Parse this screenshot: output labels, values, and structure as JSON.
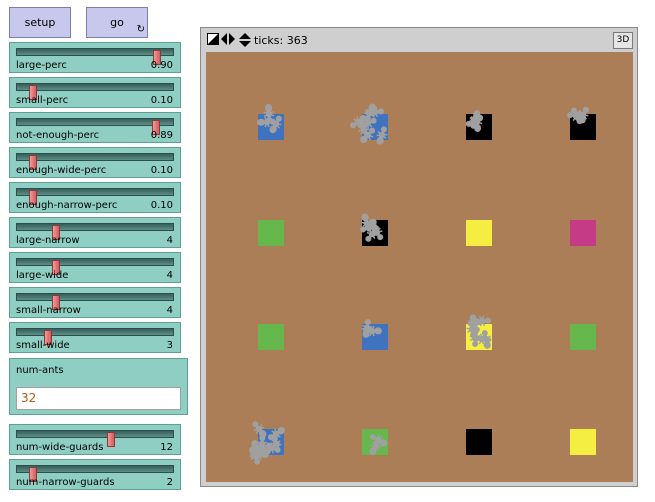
{
  "buttons": {
    "setup": "setup",
    "go": "go",
    "go_forever_icon": "forever-loop-icon"
  },
  "sliders": [
    {
      "label": "large-perc",
      "value": "0.90",
      "fraction": 0.9
    },
    {
      "label": "small-perc",
      "value": "0.10",
      "fraction": 0.1
    },
    {
      "label": "not-enough-perc",
      "value": "0.89",
      "fraction": 0.89
    },
    {
      "label": "enough-wide-perc",
      "value": "0.10",
      "fraction": 0.1
    },
    {
      "label": "enough-narrow-perc",
      "value": "0.10",
      "fraction": 0.1
    },
    {
      "label": "large-narrow",
      "value": "4",
      "fraction": 0.25
    },
    {
      "label": "large-wide",
      "value": "4",
      "fraction": 0.25
    },
    {
      "label": "small-narrow",
      "value": "4",
      "fraction": 0.25
    },
    {
      "label": "small-wide",
      "value": "3",
      "fraction": 0.2
    },
    {
      "label": "num-wide-guards",
      "value": "12",
      "fraction": 0.6
    },
    {
      "label": "num-narrow-guards",
      "value": "2",
      "fraction": 0.1
    }
  ],
  "num_ants": {
    "label": "num-ants",
    "value": "32"
  },
  "view": {
    "ticks_label": "ticks: 363",
    "btn_3d": "3D",
    "background_color": "#ac7e57",
    "patches": [
      [
        "#3f73c0",
        "#3f73c0",
        "#000000",
        "#000000"
      ],
      [
        "#66b84c",
        "#000000",
        "#f4ee42",
        "#c63b86"
      ],
      [
        "#66b84c",
        "#3f73c0",
        "#f4ee42",
        "#66b84c"
      ],
      [
        "#3f73c0",
        "#66b84c",
        "#000000",
        "#f4ee42"
      ]
    ],
    "ant_color": "#a0a0a0"
  }
}
